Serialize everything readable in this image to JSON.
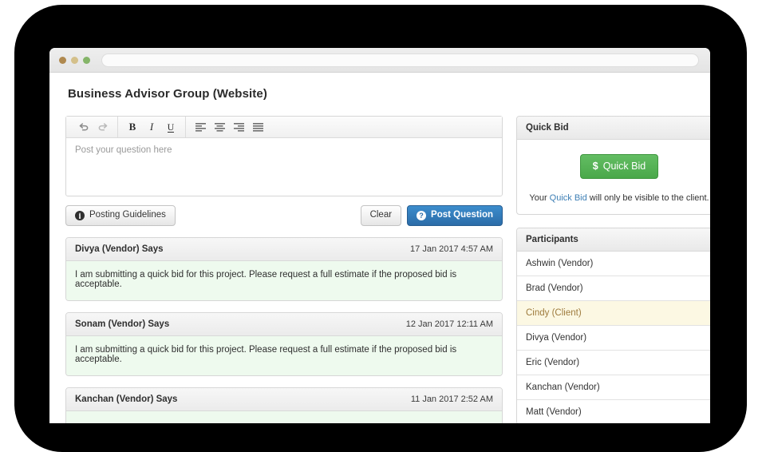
{
  "browser": {
    "url_value": "",
    "url_placeholder": ""
  },
  "page": {
    "title": "Business Advisor Group (Website)"
  },
  "editor": {
    "placeholder": "Post your question here",
    "value": "",
    "toolbar": [
      {
        "name": "undo-icon",
        "label": "Undo"
      },
      {
        "name": "redo-icon",
        "label": "Redo"
      },
      {
        "name": "bold-icon",
        "label": "B"
      },
      {
        "name": "italic-icon",
        "label": "I"
      },
      {
        "name": "underline-icon",
        "label": "U"
      },
      {
        "name": "align-left-icon",
        "label": "Align left"
      },
      {
        "name": "align-center-icon",
        "label": "Align center"
      },
      {
        "name": "align-right-icon",
        "label": "Align right"
      },
      {
        "name": "align-justify-icon",
        "label": "Justify"
      }
    ]
  },
  "actions": {
    "guidelines_label": "Posting Guidelines",
    "guidelines_icon": "info-circle-icon",
    "clear_label": "Clear",
    "post_label": "Post Question",
    "post_icon": "question-circle-icon"
  },
  "posts": [
    {
      "author": "Divya (Vendor) Says",
      "date": "17 Jan 2017 4:57 AM",
      "body": "I am submitting a quick bid for this project. Please request a full estimate if the proposed bid is acceptable."
    },
    {
      "author": "Sonam (Vendor) Says",
      "date": "12 Jan 2017 12:11 AM",
      "body": "I am submitting a quick bid for this project. Please request a full estimate if the proposed bid is acceptable."
    },
    {
      "author": "Kanchan (Vendor) Says",
      "date": "11 Jan 2017 2:52 AM",
      "body": ""
    }
  ],
  "quick_bid": {
    "panel_title": "Quick Bid",
    "button_label": "Quick Bid",
    "button_icon": "dollar-icon",
    "note_prefix": "Your ",
    "note_link": "Quick Bid",
    "note_suffix": " will only be visible to the client."
  },
  "participants": {
    "panel_title": "Participants",
    "items": [
      {
        "label": "Ashwin (Vendor)",
        "active": false
      },
      {
        "label": "Brad (Vendor)",
        "active": false
      },
      {
        "label": "Cindy (Client)",
        "active": true
      },
      {
        "label": "Divya (Vendor)",
        "active": false
      },
      {
        "label": "Eric (Vendor)",
        "active": false
      },
      {
        "label": "Kanchan (Vendor)",
        "active": false
      },
      {
        "label": "Matt (Vendor)",
        "active": false
      }
    ]
  },
  "colors": {
    "primary": "#2b6ca8",
    "success": "#4aa84a",
    "post_body": "#eefaee",
    "highlight": "#fcf8e3",
    "bezel": "#000000"
  }
}
